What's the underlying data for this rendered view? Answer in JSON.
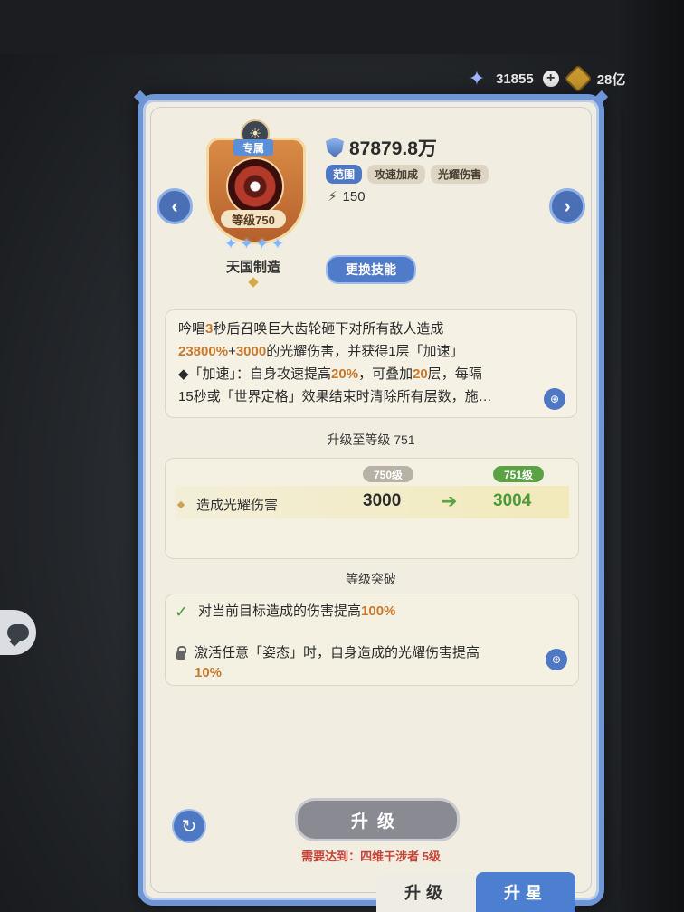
{
  "currency": {
    "stars": "31855",
    "coins": "28亿"
  },
  "card": {
    "badge": {
      "tag": "专属",
      "level": "等级750",
      "name": "天国制造",
      "star_count": 4
    },
    "power": "87879.8万",
    "tags": [
      "范围",
      "攻速加成",
      "光耀伤害"
    ],
    "energy": "150",
    "swap_label": "更换技能"
  },
  "description": {
    "line1_a": "吟唱",
    "line1_b": "3",
    "line1_c": "秒后召唤巨大齿轮砸下对所有敌人造成",
    "line2_a": "23800%",
    "line2_b": "+",
    "line2_c": "3000",
    "line2_d": "的光耀伤害，并获得1层「加速」",
    "line3_a": "◆「加速」：自身攻速提高",
    "line3_b": "20%",
    "line3_c": "，可叠加",
    "line3_d": "20",
    "line3_e": "层，每隔",
    "line4": "15秒或「世界定格」效果结束时清除所有层数，施…"
  },
  "upgrade": {
    "title": "升级至等级 751",
    "old_level": "750级",
    "new_level": "751级",
    "stat_label": "造成光耀伤害",
    "old_value": "3000",
    "new_value": "3004"
  },
  "breakthrough": {
    "title": "等级突破",
    "item1_a": "对当前目标造成的伤害提高",
    "item1_b": "100%",
    "item2_a": "激活任意「姿态」时，自身造成的光耀伤害提高",
    "item2_b": "10%"
  },
  "actions": {
    "upgrade_label": "升级",
    "requirement": "需要达到：四维干涉者 5级"
  },
  "tabs": {
    "upgrade": "升级",
    "star": "升星"
  }
}
